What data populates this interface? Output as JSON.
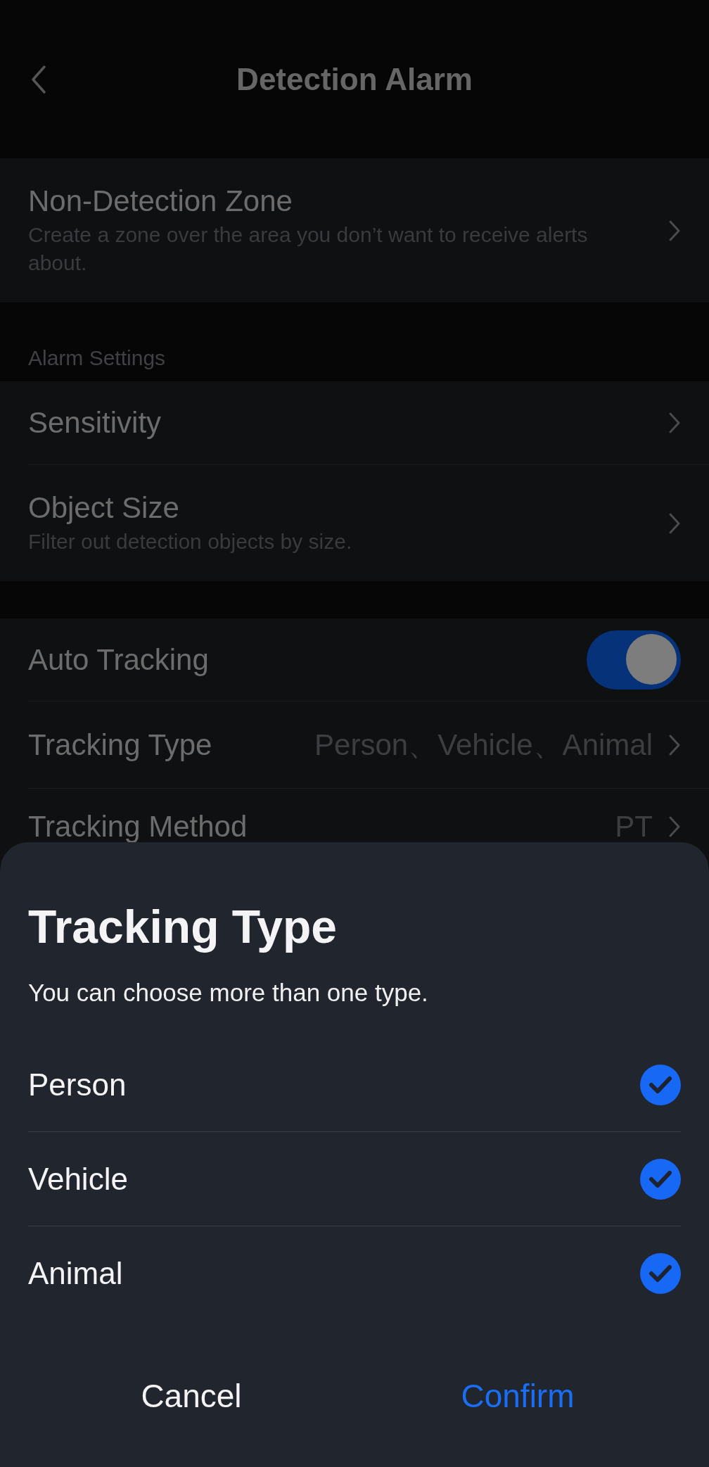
{
  "header": {
    "title": "Detection Alarm"
  },
  "sections": [
    {
      "rows": [
        {
          "kind": "link",
          "title": "Non-Detection Zone",
          "description": "Create a zone over the area you don’t want to receive alerts about."
        }
      ]
    },
    {
      "label": "Alarm Settings",
      "rows": [
        {
          "kind": "link",
          "title": "Sensitivity"
        },
        {
          "kind": "link",
          "title": "Object Size",
          "description": "Filter out detection objects by size."
        }
      ]
    },
    {
      "rows": [
        {
          "kind": "toggle",
          "title": "Auto Tracking",
          "on": true
        },
        {
          "kind": "link",
          "title": "Tracking Type",
          "value": "Person、Vehicle、Animal"
        },
        {
          "kind": "link",
          "title": "Tracking Method",
          "value": "PT"
        }
      ]
    }
  ],
  "sheet": {
    "title": "Tracking Type",
    "subtitle": "You can choose more than one type.",
    "options": [
      {
        "label": "Person",
        "checked": true
      },
      {
        "label": "Vehicle",
        "checked": true
      },
      {
        "label": "Animal",
        "checked": true
      }
    ],
    "buttons": [
      {
        "kind": "cancel",
        "label": "Cancel"
      },
      {
        "kind": "confirm",
        "label": "Confirm"
      }
    ]
  }
}
